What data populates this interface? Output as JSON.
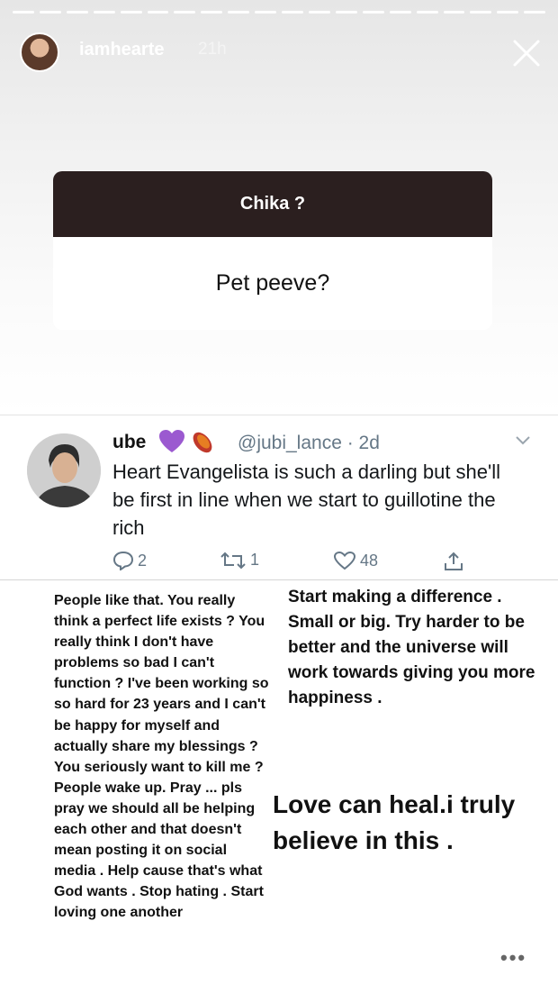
{
  "header": {
    "username": "iamhearte",
    "time_ago": "21h",
    "progress_segments": 20,
    "close_icon": "close-icon"
  },
  "question_card": {
    "prompt": "Chika ?",
    "answer": "Pet peeve?"
  },
  "tweet": {
    "display_name": "ube",
    "emojis": [
      "purple-heart-icon",
      "sweet-potato-icon"
    ],
    "handle_time": "@jubi_lance · 2d",
    "text": "Heart Evangelista is such a darling but she'll be first in line when we start to guillotine the rich",
    "actions": {
      "replies": "2",
      "retweets": "1",
      "likes": "48"
    }
  },
  "notes": {
    "left": "People like that. You really think a perfect life exists ? You really think I don't have problems so bad I can't function ? I've been working so so hard for 23 years and I can't be happy for myself and actually share my blessings ? You seriously want to kill me ? People wake up. Pray ... pls pray we should all be helping each other and that doesn't mean posting it on social media . Help cause that's what God wants . Stop hating . Start loving one another",
    "right": "Start making a difference . Small or big. Try harder to be better and the universe will work towards giving you more happiness .",
    "love": "Love can heal.i truly believe in this ."
  },
  "colors": {
    "card_header": "#2b1f1f",
    "muted": "#657786",
    "purple_heart": "#9b59d0"
  }
}
